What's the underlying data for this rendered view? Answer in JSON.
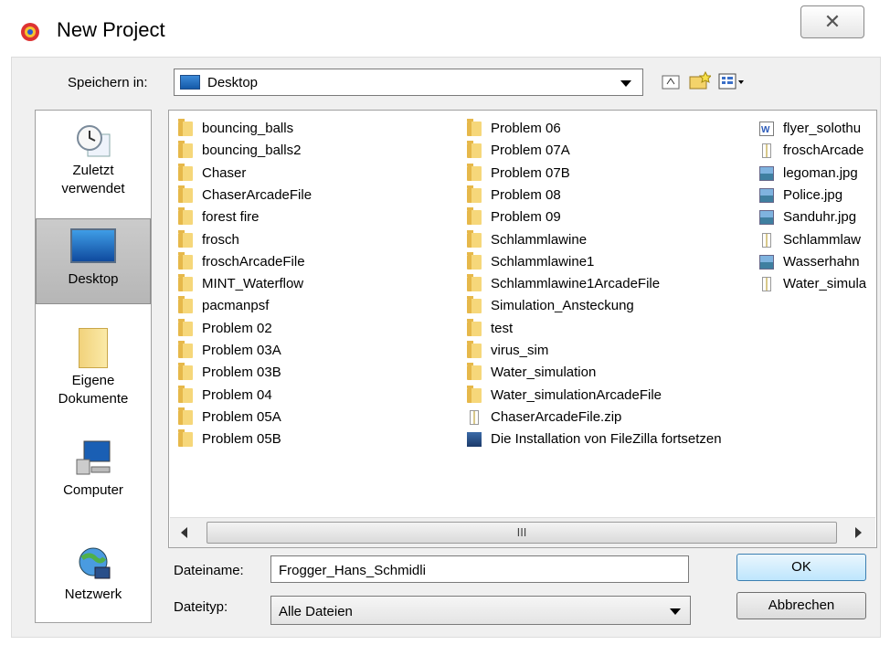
{
  "window": {
    "title": "New Project",
    "close_label": "✕"
  },
  "toolbar": {
    "save_in_label": "Speichern in:",
    "save_in_value": "Desktop"
  },
  "places": [
    {
      "label1": "Zuletzt",
      "label2": "verwendet",
      "icon": "recent-icon"
    },
    {
      "label1": "Desktop",
      "label2": "",
      "icon": "desktop-icon"
    },
    {
      "label1": "Eigene",
      "label2": "Dokumente",
      "icon": "documents-icon"
    },
    {
      "label1": "Computer",
      "label2": "",
      "icon": "computer-icon"
    },
    {
      "label1": "Netzwerk",
      "label2": "",
      "icon": "network-icon"
    }
  ],
  "files": {
    "col1": [
      "bouncing_balls",
      "bouncing_balls2",
      "Chaser",
      "ChaserArcadeFile",
      "forest fire",
      "frosch",
      "froschArcadeFile",
      "MINT_Waterflow",
      "pacmanpsf",
      "Problem 02",
      "Problem 03A",
      "Problem 03B",
      "Problem 04",
      "Problem 05A",
      "Problem 05B"
    ],
    "col2": [
      "Problem 06",
      "Problem 07A",
      "Problem 07B",
      "Problem 08",
      "Problem 09",
      "Schlammlawine",
      "Schlammlawine1",
      "Schlammlawine1ArcadeFile",
      "Simulation_Ansteckung",
      "test",
      "virus_sim",
      "Water_simulation",
      "Water_simulationArcadeFile",
      "ChaserArcadeFile.zip",
      "Die Installation von FileZilla fortsetzen"
    ],
    "col2_types": [
      "folder",
      "folder",
      "folder",
      "folder",
      "folder",
      "folder",
      "folder",
      "folder",
      "folder",
      "folder",
      "folder",
      "folder",
      "folder",
      "zip",
      "link"
    ],
    "col3": [
      "flyer_solothu",
      "froschArcade",
      "legoman.jpg",
      "Police.jpg",
      "Sanduhr.jpg",
      "Schlammlaw",
      "Wasserhahn",
      "Water_simula"
    ],
    "col3_types": [
      "doc",
      "zip",
      "image",
      "image",
      "image",
      "zip",
      "image",
      "zip"
    ]
  },
  "scrollbar": {
    "grip": "III"
  },
  "form": {
    "filename_label": "Dateiname:",
    "filename_value": "Frogger_Hans_Schmidli",
    "filetype_label": "Dateityp:",
    "filetype_value": "Alle Dateien",
    "ok_label": "OK",
    "cancel_label": "Abbrechen"
  }
}
